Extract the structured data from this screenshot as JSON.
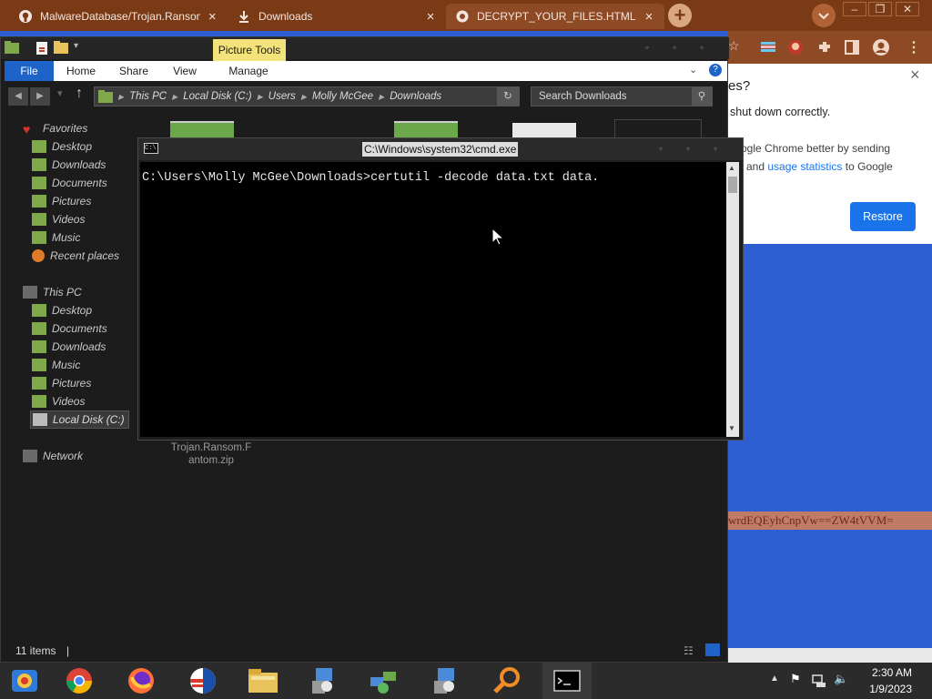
{
  "chrome": {
    "tabs": [
      {
        "title": "MalwareDatabase/Trojan.Ransom",
        "icon": "github-icon"
      },
      {
        "title": "Downloads",
        "icon": "download-icon"
      },
      {
        "title": "DECRYPT_YOUR_FILES.HTML",
        "icon": "globe-icon"
      }
    ],
    "new_tab": "+",
    "dialog": {
      "title_fragment": "es?",
      "message": "shut down correctly.",
      "body_line1": "ogle Chrome better by sending",
      "body_line2_prefix": "and",
      "body_link": "usage statistics",
      "body_line2_suffix": "to Google",
      "restore_label": "Restore",
      "close": "×"
    },
    "ransom_fragment": "wrdEQEyhCnpVw==ZW4tVVM=",
    "colors": {
      "frame": "#7b3a16",
      "accent": "#1a73e8",
      "page_bg": "#2d5fd3"
    }
  },
  "explorer": {
    "picture_tools": "Picture Tools",
    "ribbon": {
      "file": "File",
      "home": "Home",
      "share": "Share",
      "view": "View",
      "manage": "Manage"
    },
    "address": [
      "This PC",
      "Local Disk (C:)",
      "Users",
      "Molly McGee",
      "Downloads"
    ],
    "search_placeholder": "Search Downloads",
    "favorites_label": "Favorites",
    "favorites": [
      "Desktop",
      "Downloads",
      "Documents",
      "Pictures",
      "Videos",
      "Music",
      "Recent places"
    ],
    "this_pc_label": "This PC",
    "this_pc": [
      "Desktop",
      "Documents",
      "Downloads",
      "Music",
      "Pictures",
      "Videos",
      "Local Disk (C:)"
    ],
    "network_label": "Network",
    "file_label_line1": "Trojan.Ransom.F",
    "file_label_line2": "antom.zip",
    "status": "11 items"
  },
  "cmd": {
    "title": "C:\\Windows\\system32\\cmd.exe",
    "command_line": "C:\\Users\\Molly McGee\\Downloads>certutil -decode data.txt data."
  },
  "taskbar": {
    "items": [
      "explorer-icon",
      "chrome-icon",
      "firefox-icon",
      "election-icon",
      "folder-icon",
      "setup-icon",
      "network-icon",
      "setup-icon",
      "search-icon",
      "cmd-icon"
    ],
    "time": "2:30 AM",
    "date": "1/9/2023"
  }
}
